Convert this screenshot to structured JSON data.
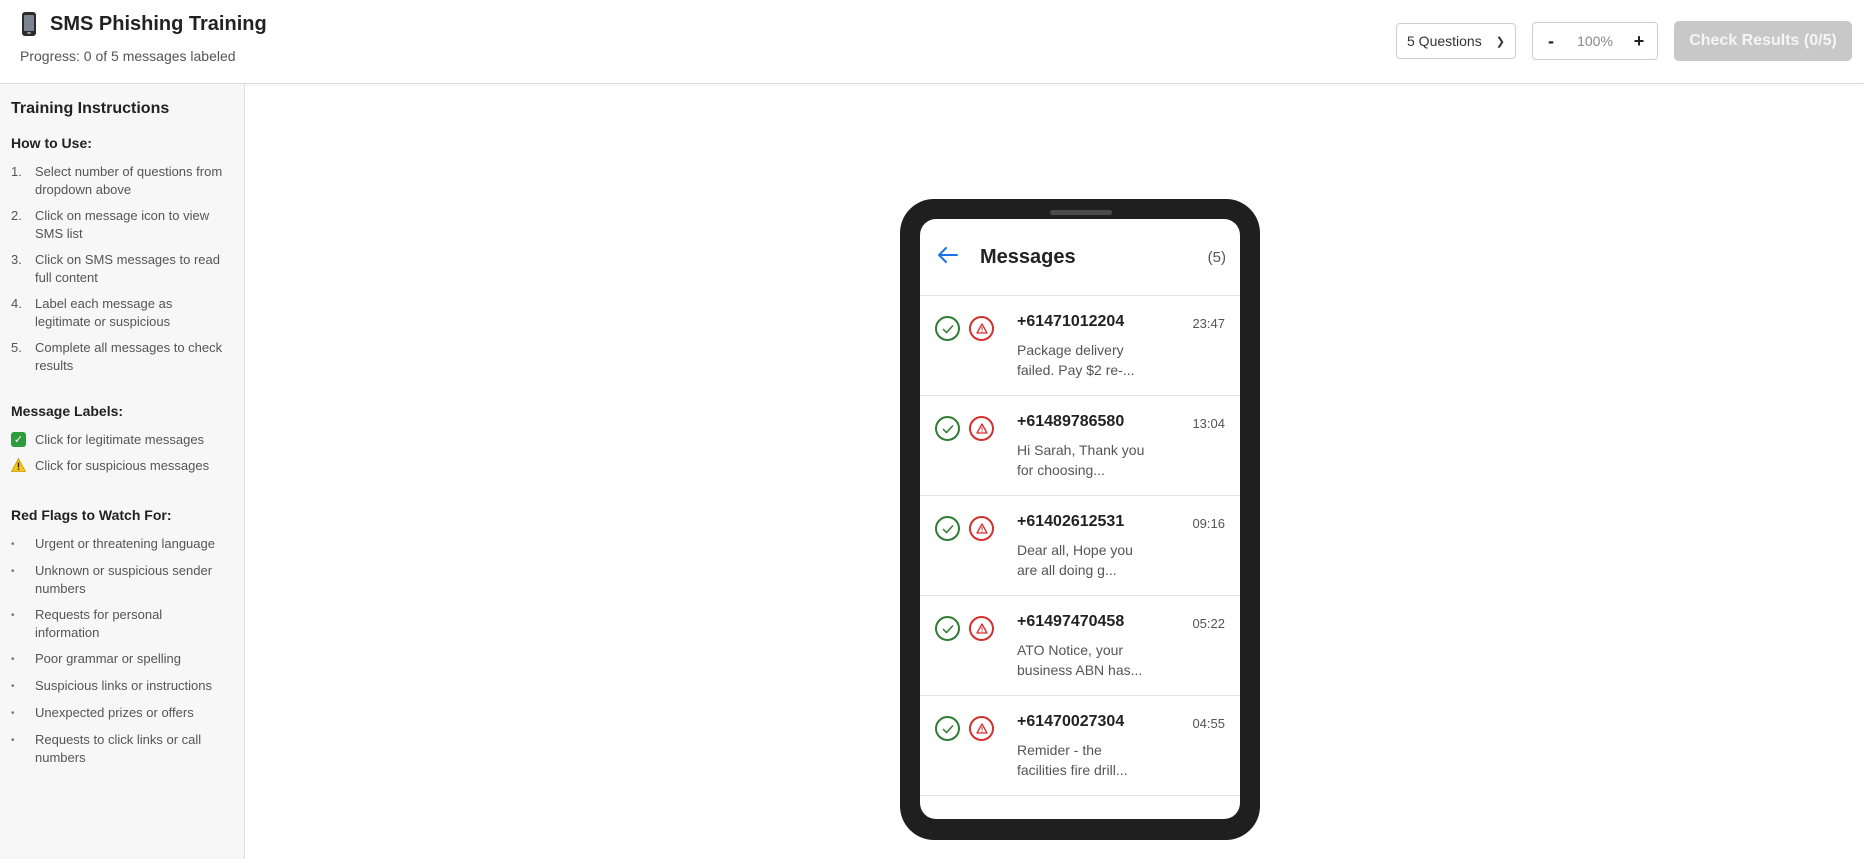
{
  "header": {
    "title": "SMS Phishing Training",
    "progress": "Progress: 0 of 5 messages labeled",
    "question_select": {
      "value": "5 Questions"
    },
    "zoom": {
      "minus": "-",
      "value": "100%",
      "plus": "+"
    },
    "check_button": "Check Results (0/5)"
  },
  "sidebar": {
    "title": "Training Instructions",
    "how_to_use": {
      "heading": "How to Use:",
      "steps": [
        {
          "num": "1.",
          "text": "Select number of questions from dropdown above"
        },
        {
          "num": "2.",
          "text": "Click on message icon to view SMS list"
        },
        {
          "num": "3.",
          "text": "Click on SMS messages to read full content"
        },
        {
          "num": "4.",
          "text": "Label each message as legitimate or suspicious"
        },
        {
          "num": "5.",
          "text": "Complete all messages to check results"
        }
      ]
    },
    "labels": {
      "heading": "Message Labels:",
      "legit": "Click for legitimate messages",
      "suspicious": "Click for suspicious messages"
    },
    "red_flags": {
      "heading": "Red Flags to Watch For:",
      "items": [
        "Urgent or threatening language",
        "Unknown or suspicious sender numbers",
        "Requests for personal information",
        "Poor grammar or spelling",
        "Suspicious links or instructions",
        "Unexpected prizes or offers",
        "Requests to click links or call numbers"
      ]
    }
  },
  "phone": {
    "title": "Messages",
    "count": "(5)",
    "messages": [
      {
        "sender": "+61471012204",
        "time": "23:47",
        "preview": "Package delivery failed. Pay $2 re-..."
      },
      {
        "sender": "+61489786580",
        "time": "13:04",
        "preview": "Hi Sarah, Thank you for choosing..."
      },
      {
        "sender": "+61402612531",
        "time": "09:16",
        "preview": "Dear all, Hope you are all doing g..."
      },
      {
        "sender": "+61497470458",
        "time": "05:22",
        "preview": "ATO Notice, your business ABN has..."
      },
      {
        "sender": "+61470027304",
        "time": "04:55",
        "preview": "Remider - the facilities fire drill..."
      }
    ]
  },
  "colors": {
    "legit_green": "#2e7d32",
    "suspicious_red": "#d32f2f",
    "back_blue": "#1a73e8",
    "disabled_button": "#c8c8c8"
  }
}
